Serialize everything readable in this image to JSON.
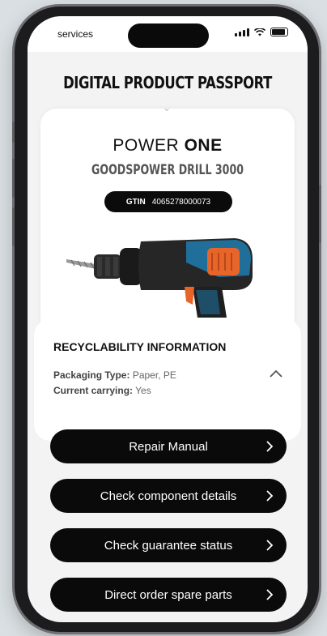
{
  "status_bar": {
    "carrier": "services",
    "icons": [
      "signal-icon",
      "wifi-icon",
      "battery-icon"
    ]
  },
  "page": {
    "title": "DIGITAL PRODUCT PASSPORT"
  },
  "product": {
    "brand_light": "POWER",
    "brand_bold": "ONE",
    "model": "GOODSPOWER DRILL 3000",
    "gtin_label": "GTIN",
    "gtin_value": "4065278000073",
    "image": "cordless-drill-image"
  },
  "recyclability": {
    "title": "RECYCLABILITY INFORMATION",
    "packaging_label": "Packaging Type:",
    "packaging_value": "Paper, PE",
    "current_label": "Current carrying:",
    "current_value": "Yes",
    "expanded": true
  },
  "actions": [
    {
      "label": "Repair Manual"
    },
    {
      "label": "Check component details"
    },
    {
      "label": "Check guarantee status"
    },
    {
      "label": "Direct order spare parts"
    }
  ],
  "colors": {
    "button_bg": "#0a0a0a",
    "button_text": "#ffffff",
    "card_bg": "#ffffff",
    "screen_bg": "#f3f3f3",
    "accent_orange": "#e8652a",
    "accent_blue": "#1f6f9a"
  }
}
